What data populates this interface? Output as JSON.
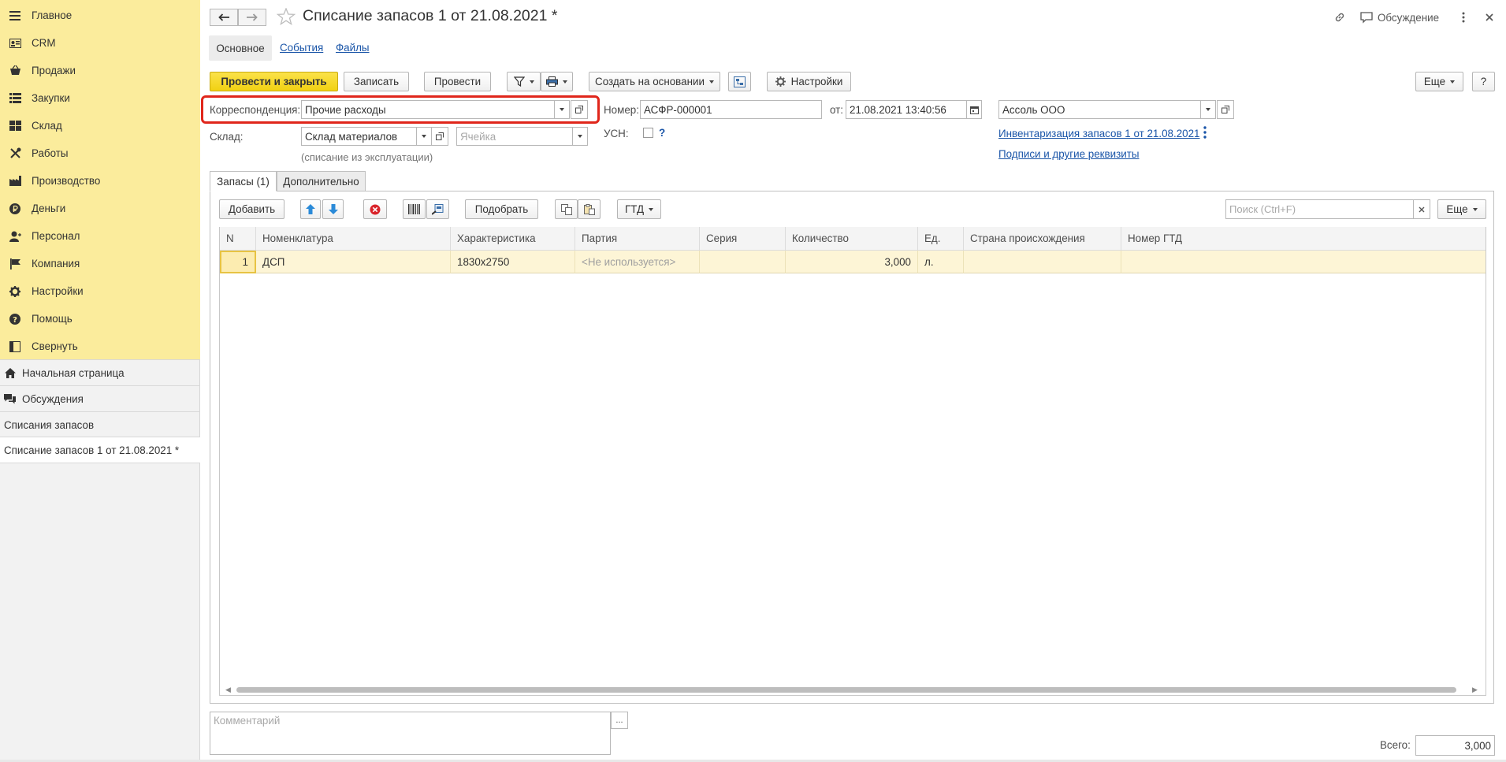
{
  "sidebar": {
    "nav": [
      {
        "label": "Главное",
        "icon": "menu-icon"
      },
      {
        "label": "CRM",
        "icon": "crm-card-icon"
      },
      {
        "label": "Продажи",
        "icon": "basket-icon"
      },
      {
        "label": "Закупки",
        "icon": "purchases-list-icon"
      },
      {
        "label": "Склад",
        "icon": "warehouse-grid-icon"
      },
      {
        "label": "Работы",
        "icon": "tools-icon"
      },
      {
        "label": "Производство",
        "icon": "factory-icon"
      },
      {
        "label": "Деньги",
        "icon": "ruble-coin-icon"
      },
      {
        "label": "Персонал",
        "icon": "person-icon"
      },
      {
        "label": "Компания",
        "icon": "flag-icon"
      },
      {
        "label": "Настройки",
        "icon": "gear-icon"
      },
      {
        "label": "Помощь",
        "icon": "help-icon"
      },
      {
        "label": "Свернуть",
        "icon": "collapse-panel-icon"
      }
    ],
    "open_windows": [
      {
        "label": "Начальная страница",
        "icon": "home-icon"
      },
      {
        "label": "Обсуждения",
        "icon": "discussions-icon"
      },
      {
        "label": "Списания запасов",
        "icon": ""
      },
      {
        "label": "Списание запасов 1 от 21.08.2021 *",
        "icon": "",
        "active": true
      }
    ]
  },
  "header": {
    "title": "Списание запасов 1 от 21.08.2021 *",
    "discussion_label": "Обсуждение"
  },
  "section_tabs": {
    "main": "Основное",
    "events": "События",
    "files": "Файлы"
  },
  "toolbar": {
    "post_and_close": "Провести и закрыть",
    "save": "Записать",
    "post": "Провести",
    "create_based_on": "Создать на основании",
    "settings": "Настройки",
    "more": "Еще",
    "help": "?"
  },
  "form": {
    "correspondence_label": "Корреспонденция:",
    "correspondence_value": "Прочие расходы",
    "number_label": "Номер:",
    "number_value": "АСФР-000001",
    "date_label": "от:",
    "date_value": "21.08.2021 13:40:56",
    "company_value": "Ассоль ООО",
    "warehouse_label": "Склад:",
    "warehouse_value": "Склад материалов",
    "cell_placeholder": "Ячейка",
    "warehouse_hint": "(списание из эксплуатации)",
    "usn_label": "УСН:",
    "usn_help": "?",
    "usn_checked": false,
    "inventory_link": "Инвентаризация запасов 1 от 21.08.2021",
    "signatures_link": "Подписи и другие реквизиты"
  },
  "page_tabs": {
    "stocks": "Запасы (1)",
    "additional": "Дополнительно"
  },
  "table_toolbar": {
    "add": "Добавить",
    "pick": "Подобрать",
    "gtd": "ГТД",
    "search_placeholder": "Поиск (Ctrl+F)",
    "more": "Еще"
  },
  "table": {
    "columns": [
      "N",
      "Номенклатура",
      "Характеристика",
      "Партия",
      "Серия",
      "Количество",
      "Ед.",
      "Страна происхождения",
      "Номер ГТД"
    ],
    "rows": [
      [
        "1",
        "ДСП",
        "1830x2750",
        "<Не используется>",
        "",
        "3,000",
        "л.",
        "",
        ""
      ]
    ]
  },
  "footer": {
    "comment_placeholder": "Комментарий",
    "comment_btn": "...",
    "total_label": "Всего:",
    "total_value": "3,000"
  },
  "colors": {
    "sidebar_nav_bg": "#fbec9c",
    "primary_button": "#f1d112",
    "link": "#1a55a8",
    "highlight_border": "#e0261b",
    "selected_row": "#fdf5d6"
  }
}
